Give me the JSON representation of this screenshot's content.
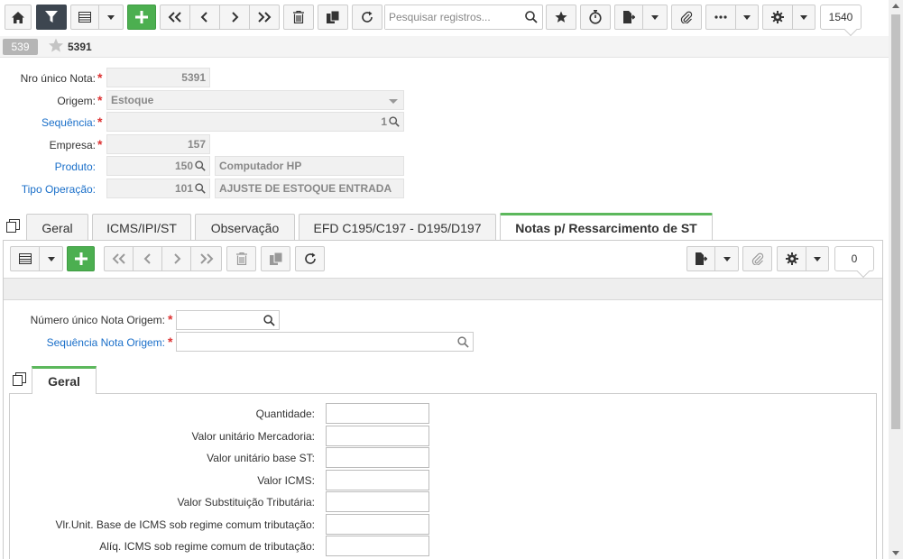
{
  "toolbar": {
    "search_placeholder": "Pesquisar registros...",
    "record_count": "1540"
  },
  "record": {
    "badge": "539",
    "number": "5391"
  },
  "form": {
    "nro_unico": {
      "label": "Nro único Nota:",
      "value": "5391"
    },
    "origem": {
      "label": "Origem:",
      "value": "Estoque"
    },
    "sequencia": {
      "label": "Sequência:",
      "value": "1"
    },
    "empresa": {
      "label": "Empresa:",
      "value": "157"
    },
    "produto": {
      "label": "Produto:",
      "code": "150",
      "description": "Computador HP"
    },
    "tipo_operacao": {
      "label": "Tipo Operação:",
      "code": "101",
      "description": "AJUSTE DE ESTOQUE ENTRADA"
    }
  },
  "tabs": [
    {
      "label": "Geral"
    },
    {
      "label": "ICMS/IPI/ST"
    },
    {
      "label": "Observação"
    },
    {
      "label": "EFD C195/C197 - D195/D197"
    },
    {
      "label": "Notas p/ Ressarcimento de ST"
    }
  ],
  "detail": {
    "record_count": "0",
    "numero_unico_label": "Número único Nota Origem:",
    "sequencia_label": "Sequência Nota Origem:",
    "subtab_label": "Geral",
    "fields": [
      {
        "label": "Quantidade:"
      },
      {
        "label": "Valor unitário Mercadoria:"
      },
      {
        "label": "Valor unitário base ST:"
      },
      {
        "label": "Valor ICMS:"
      },
      {
        "label": "Valor Substituição Tributária:"
      },
      {
        "label": "Vlr.Unit. Base de ICMS sob regime comum tributação:"
      },
      {
        "label": "Alíq. ICMS sob regime comum de tributação:"
      }
    ]
  },
  "colors": {
    "accent_green": "#4caf50",
    "link_blue": "#1a6fc9",
    "required_red": "#dd3333",
    "dark_button": "#3d4650"
  }
}
